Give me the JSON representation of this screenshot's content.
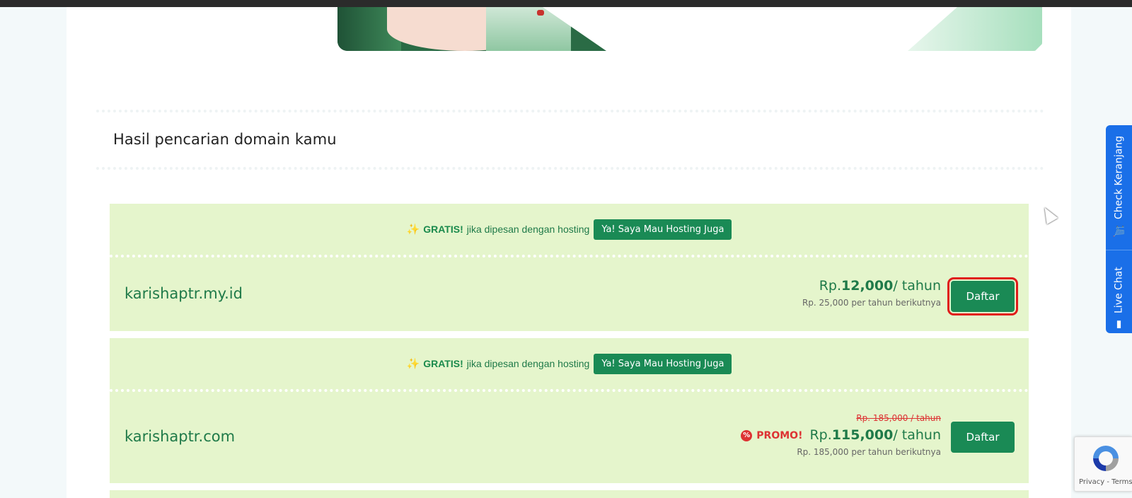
{
  "results": {
    "title": "Hasil pencarian domain kamu"
  },
  "promo": {
    "sparkle_icon": "sparkle-icon",
    "gratis": "GRATIS!",
    "text": "jika dipesan dengan hosting",
    "hosting_button": "Ya! Saya Mau Hosting Juga"
  },
  "domains": [
    {
      "name": "karishaptr.my.id",
      "price_prefix": "Rp.",
      "price_value": "12,000",
      "price_suffix": "/ tahun",
      "renewal": "Rp. 25,000 per tahun berikutnya",
      "button": "Daftar"
    },
    {
      "name": "karishaptr.com",
      "old_price": "Rp. 185,000 / tahun",
      "promo_label": "PROMO!",
      "price_prefix": "Rp.",
      "price_value": "115,000",
      "price_suffix": "/ tahun",
      "renewal": "Rp. 185,000 per tahun berikutnya",
      "button": "Daftar"
    }
  ],
  "side_tab": {
    "cart": "Check Keranjang",
    "chat": "Live Chat"
  },
  "recaptcha": {
    "links": "Privacy - Terms"
  },
  "colors": {
    "brand_green": "#1a8a55",
    "card_bg": "#e5f5cc",
    "promo_red": "#dd3333",
    "side_tab_blue": "#1a6fe8"
  }
}
